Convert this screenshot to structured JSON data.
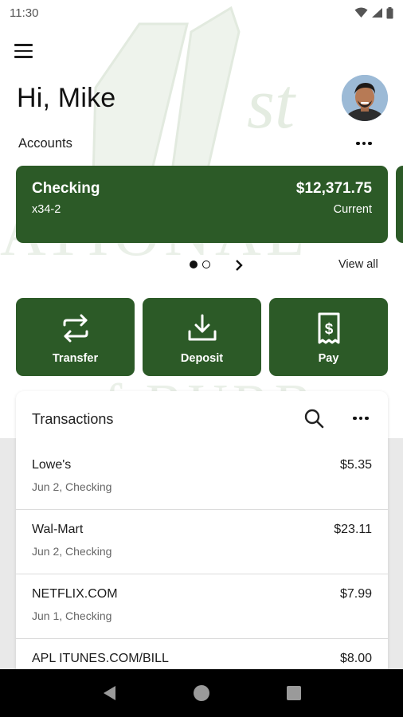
{
  "status_bar": {
    "time": "11:30",
    "icons": [
      "wifi-icon",
      "signal-icon",
      "battery-icon"
    ]
  },
  "header": {
    "menu_icon": "menu-icon",
    "greeting": "Hi, Mike",
    "avatar": "user-avatar"
  },
  "accounts": {
    "label": "Accounts",
    "more_icon": "more-horizontal-icon",
    "cards": [
      {
        "name": "Checking",
        "number": "x34-2",
        "balance": "$12,371.75",
        "status": "Current"
      }
    ],
    "pager_active_index": 0,
    "pager_count": 2,
    "view_all": "View all"
  },
  "actions": [
    {
      "label": "Transfer",
      "icon": "transfer-arrows-icon"
    },
    {
      "label": "Deposit",
      "icon": "download-tray-icon"
    },
    {
      "label": "Pay",
      "icon": "receipt-dollar-icon"
    }
  ],
  "transactions": {
    "title": "Transactions",
    "search_icon": "search-icon",
    "more_icon": "more-horizontal-icon",
    "items": [
      {
        "merchant": "Lowe's",
        "meta": "Jun 2, Checking",
        "amount": "$5.35"
      },
      {
        "merchant": "Wal-Mart",
        "meta": "Jun 2, Checking",
        "amount": "$23.11"
      },
      {
        "merchant": "NETFLIX.COM",
        "meta": "Jun 1, Checking",
        "amount": "$7.99"
      },
      {
        "merchant": "APL ITUNES.COM/BILL",
        "meta": "",
        "amount": "$8.00"
      }
    ]
  },
  "nav_bar": {
    "buttons": [
      "back-icon",
      "home-icon",
      "recents-icon"
    ]
  },
  "colors": {
    "brand_green": "#2c5a27",
    "watermark_green": "#e6ede4",
    "background_grey": "#e9e9e9"
  }
}
